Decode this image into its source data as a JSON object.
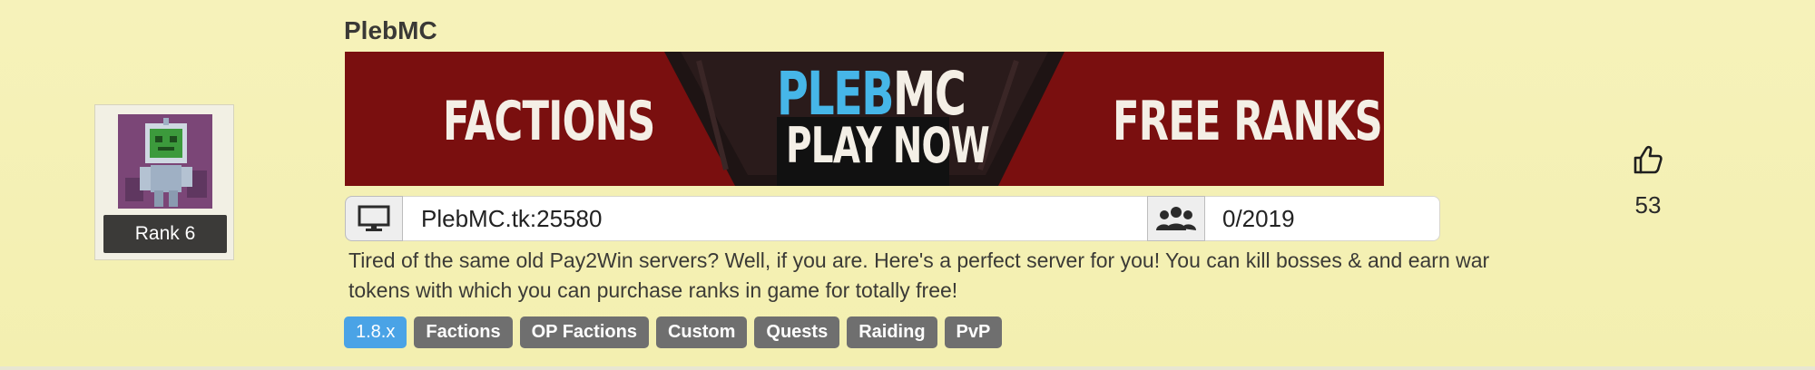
{
  "server": {
    "title": "PlebMC",
    "rank_label": "Rank 6",
    "banner": {
      "left_text": "FACTIONS",
      "brand_part1": "PLEB",
      "brand_part2": "MC",
      "cta_text": "PLAY NOW",
      "right_text": "FREE RANKS"
    },
    "address": "PlebMC.tk:25580",
    "players": "0/2019",
    "description": "Tired of the same old Pay2Win servers? Well, if you are. Here's a perfect server for you! You can kill bosses & and earn war tokens with which you can purchase ranks in game for totally free!",
    "tags": [
      "1.8.x",
      "Factions",
      "OP Factions",
      "Custom",
      "Quests",
      "Raiding",
      "PvP"
    ],
    "votes": "53"
  },
  "icons": {
    "address": "monitor-icon",
    "players": "users-icon",
    "vote": "thumbs-up-icon"
  },
  "colors": {
    "card_background": "#f5f1b6",
    "banner_background": "#7a0f0f",
    "tag_version": "#4aa3e6",
    "tag_default": "#6f6f6f",
    "rank_label_bg": "#3b3a38"
  }
}
